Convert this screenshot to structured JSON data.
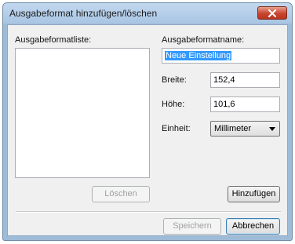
{
  "window": {
    "title": "Ausgabeformat hinzufügen/löschen"
  },
  "list_panel": {
    "label": "Ausgabeformatliste:",
    "items": [],
    "delete_button": "Löschen"
  },
  "form": {
    "name_label": "Ausgabeformatname:",
    "name_value": "Neue Einstellung",
    "width_label": "Breite:",
    "width_value": "152,4",
    "height_label": "Höhe:",
    "height_value": "101,6",
    "unit_label": "Einheit:",
    "unit_value": "Millimeter",
    "add_button": "Hinzufügen"
  },
  "footer": {
    "save_button": "Speichern",
    "cancel_button": "Abbrechen"
  },
  "colors": {
    "titlebar": "#a9c5e3",
    "close": "#c9452f",
    "selection": "#3399ff"
  },
  "icons": [
    "close-icon",
    "chevron-down-icon"
  ]
}
